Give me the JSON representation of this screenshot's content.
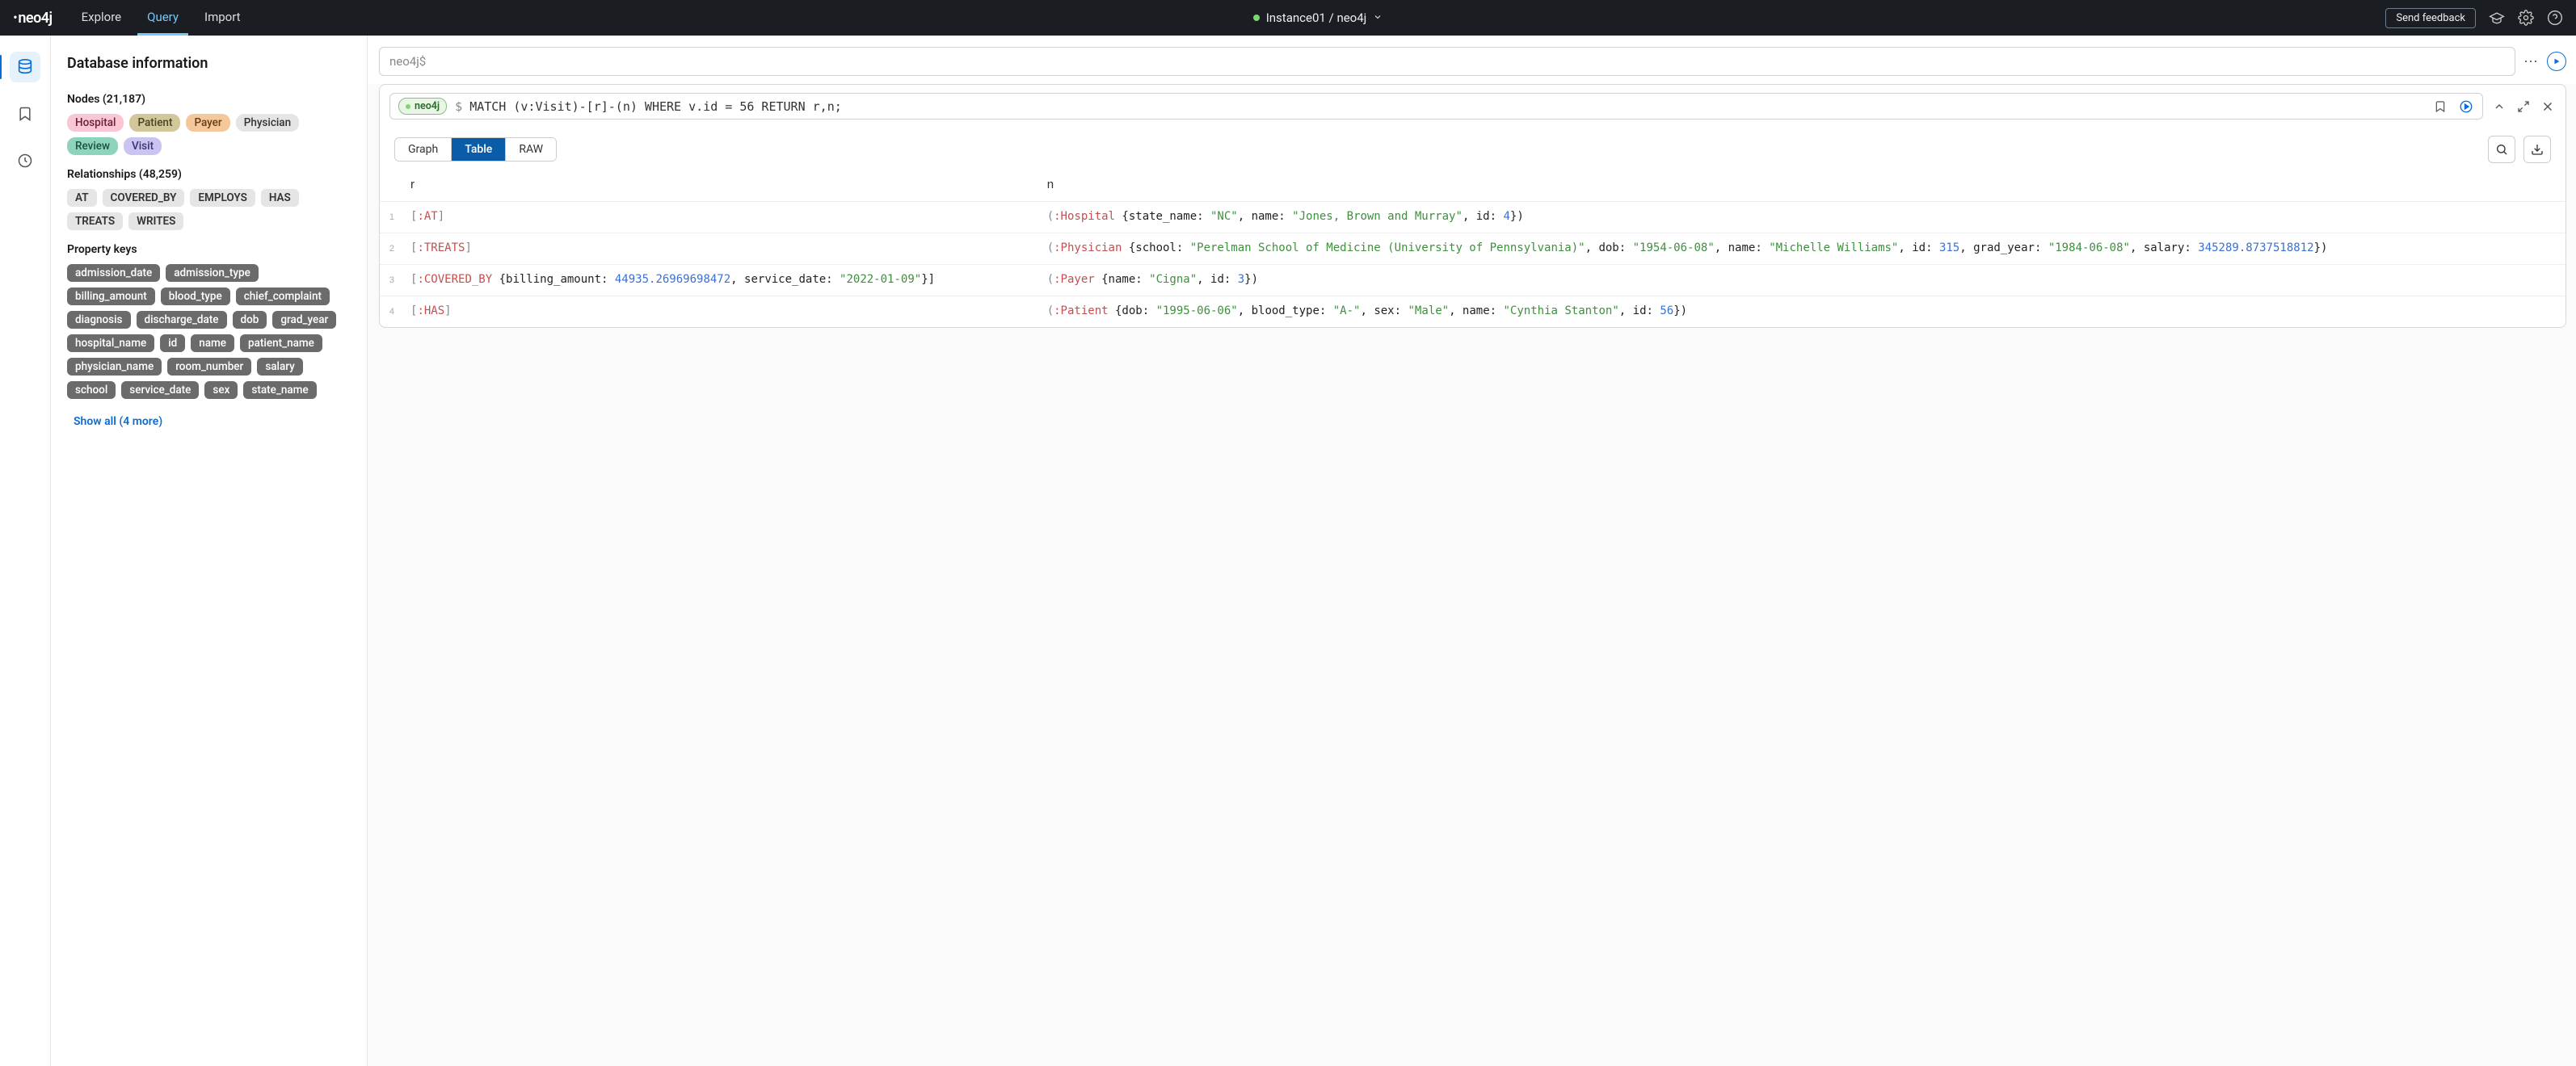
{
  "header": {
    "logo_text": "neo4j",
    "tabs": [
      "Explore",
      "Query",
      "Import"
    ],
    "active_tab": 1,
    "instance": "Instance01 / neo4j",
    "feedback_label": "Send feedback"
  },
  "sidebar": {
    "title": "Database information",
    "nodes_label": "Nodes (21,187)",
    "node_labels": [
      {
        "text": "Hospital",
        "cls": "pink"
      },
      {
        "text": "Patient",
        "cls": "olive"
      },
      {
        "text": "Payer",
        "cls": "orange"
      },
      {
        "text": "Physician",
        "cls": "grey"
      },
      {
        "text": "Review",
        "cls": "teal"
      },
      {
        "text": "Visit",
        "cls": "lav"
      }
    ],
    "rel_label": "Relationships (48,259)",
    "relationships": [
      "AT",
      "COVERED_BY",
      "EMPLOYS",
      "HAS",
      "TREATS",
      "WRITES"
    ],
    "prop_label": "Property keys",
    "properties": [
      "admission_date",
      "admission_type",
      "billing_amount",
      "blood_type",
      "chief_complaint",
      "diagnosis",
      "discharge_date",
      "dob",
      "grad_year",
      "hospital_name",
      "id",
      "name",
      "patient_name",
      "physician_name",
      "room_number",
      "salary",
      "school",
      "service_date",
      "sex",
      "state_name"
    ],
    "show_all": "Show all (4 more)"
  },
  "query_input": {
    "placeholder": "neo4j$"
  },
  "result": {
    "db_badge": "neo4j",
    "query_prefix": "$ ",
    "query": "MATCH (v:Visit)-[r]-(n) WHERE v.id = 56 RETURN r,n;",
    "view_tabs": [
      "Graph",
      "Table",
      "RAW"
    ],
    "active_view": 1,
    "columns": [
      "r",
      "n"
    ],
    "rows": [
      {
        "num": "1",
        "r": [
          {
            "t": "[",
            "c": "c-grey"
          },
          {
            "t": ":AT",
            "c": "c-red"
          },
          {
            "t": "]",
            "c": "c-grey"
          }
        ],
        "n": [
          {
            "t": "(",
            "c": "c-grey"
          },
          {
            "t": ":Hospital",
            "c": "c-red"
          },
          {
            "t": " {state_name: ",
            "c": "c-black"
          },
          {
            "t": "\"NC\"",
            "c": "c-green"
          },
          {
            "t": ", name: ",
            "c": "c-black"
          },
          {
            "t": "\"Jones, Brown and Murray\"",
            "c": "c-green"
          },
          {
            "t": ", id: ",
            "c": "c-black"
          },
          {
            "t": "4",
            "c": "c-blue"
          },
          {
            "t": "})",
            "c": "c-black"
          }
        ]
      },
      {
        "num": "2",
        "r": [
          {
            "t": "[",
            "c": "c-grey"
          },
          {
            "t": ":TREATS",
            "c": "c-red"
          },
          {
            "t": "]",
            "c": "c-grey"
          }
        ],
        "n": [
          {
            "t": "(",
            "c": "c-grey"
          },
          {
            "t": ":Physician",
            "c": "c-red"
          },
          {
            "t": " {school: ",
            "c": "c-black"
          },
          {
            "t": "\"Perelman School of Medicine (University of Pennsylvania)\"",
            "c": "c-green"
          },
          {
            "t": ", dob: ",
            "c": "c-black"
          },
          {
            "t": "\"1954-06-08\"",
            "c": "c-green"
          },
          {
            "t": ", name: ",
            "c": "c-black"
          },
          {
            "t": "\"Michelle Williams\"",
            "c": "c-green"
          },
          {
            "t": ", id: ",
            "c": "c-black"
          },
          {
            "t": "315",
            "c": "c-blue"
          },
          {
            "t": ", grad_year: ",
            "c": "c-black"
          },
          {
            "t": "\"1984-06-08\"",
            "c": "c-green"
          },
          {
            "t": ", salary: ",
            "c": "c-black"
          },
          {
            "t": "345289.8737518812",
            "c": "c-blue"
          },
          {
            "t": "})",
            "c": "c-black"
          }
        ]
      },
      {
        "num": "3",
        "r": [
          {
            "t": "[",
            "c": "c-grey"
          },
          {
            "t": ":COVERED_BY",
            "c": "c-red"
          },
          {
            "t": " {billing_amount: ",
            "c": "c-black"
          },
          {
            "t": "44935.26969698472",
            "c": "c-blue"
          },
          {
            "t": ", service_date: ",
            "c": "c-black"
          },
          {
            "t": "\"2022-01-09\"",
            "c": "c-green"
          },
          {
            "t": "}]",
            "c": "c-black"
          }
        ],
        "n": [
          {
            "t": "(",
            "c": "c-grey"
          },
          {
            "t": ":Payer",
            "c": "c-red"
          },
          {
            "t": " {name: ",
            "c": "c-black"
          },
          {
            "t": "\"Cigna\"",
            "c": "c-green"
          },
          {
            "t": ", id: ",
            "c": "c-black"
          },
          {
            "t": "3",
            "c": "c-blue"
          },
          {
            "t": "})",
            "c": "c-black"
          }
        ]
      },
      {
        "num": "4",
        "r": [
          {
            "t": "[",
            "c": "c-grey"
          },
          {
            "t": ":HAS",
            "c": "c-red"
          },
          {
            "t": "]",
            "c": "c-grey"
          }
        ],
        "n": [
          {
            "t": "(",
            "c": "c-grey"
          },
          {
            "t": ":Patient",
            "c": "c-red"
          },
          {
            "t": " {dob: ",
            "c": "c-black"
          },
          {
            "t": "\"1995-06-06\"",
            "c": "c-green"
          },
          {
            "t": ", blood_type: ",
            "c": "c-black"
          },
          {
            "t": "\"A-\"",
            "c": "c-green"
          },
          {
            "t": ", sex: ",
            "c": "c-black"
          },
          {
            "t": "\"Male\"",
            "c": "c-green"
          },
          {
            "t": ", name: ",
            "c": "c-black"
          },
          {
            "t": "\"Cynthia Stanton\"",
            "c": "c-green"
          },
          {
            "t": ", id: ",
            "c": "c-black"
          },
          {
            "t": "56",
            "c": "c-blue"
          },
          {
            "t": "})",
            "c": "c-black"
          }
        ]
      }
    ]
  }
}
